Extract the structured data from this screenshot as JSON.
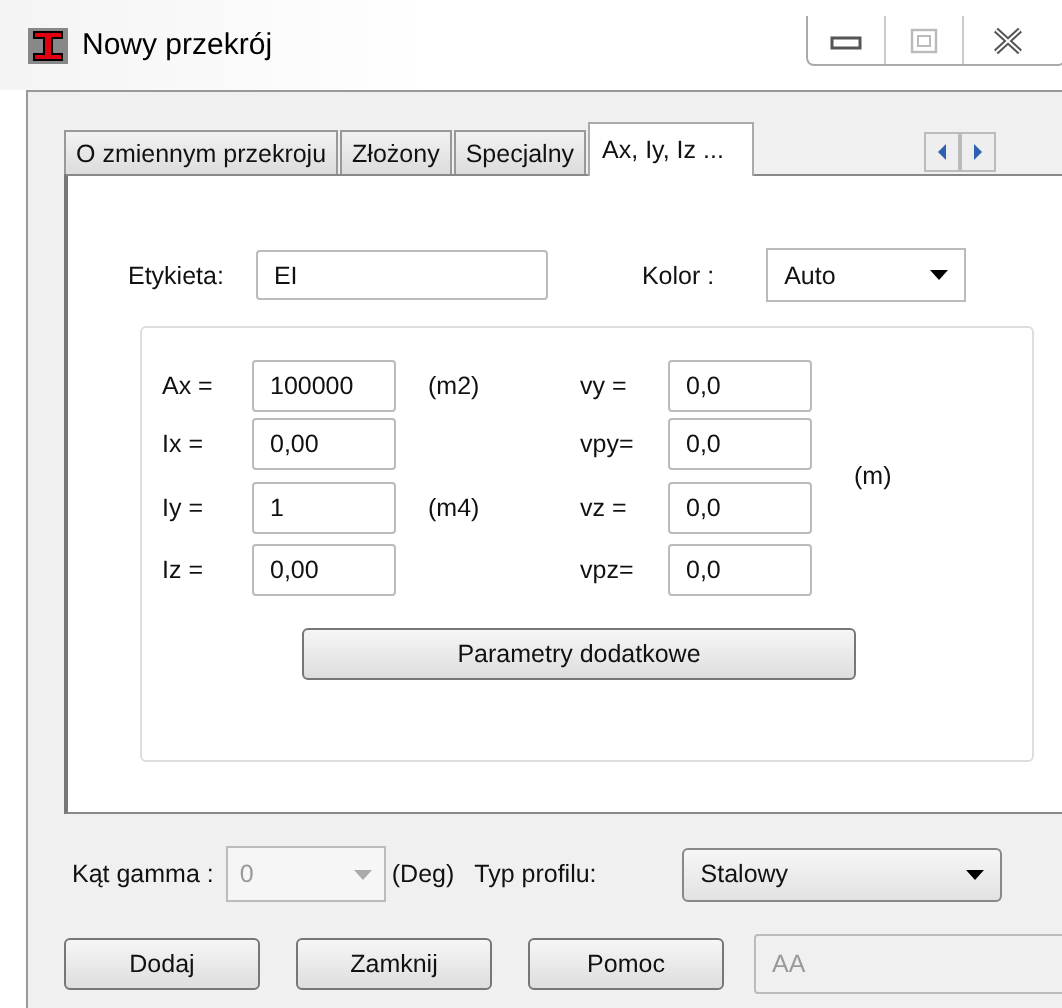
{
  "window": {
    "title": "Nowy przekrój"
  },
  "tabs": [
    {
      "label": "O zmiennym przekroju",
      "selected": false
    },
    {
      "label": "Złożony",
      "selected": false
    },
    {
      "label": "Specjalny",
      "selected": false
    },
    {
      "label": "Ax, Iy, Iz ...",
      "selected": true
    }
  ],
  "label_field": {
    "label": "Etykieta:",
    "value": "EI"
  },
  "color_field": {
    "label": "Kolor :",
    "value": "Auto"
  },
  "properties": {
    "left": [
      {
        "label": "Ax =",
        "value": "100000",
        "unit": "(m2)"
      },
      {
        "label": "Ix =",
        "value": "0,00"
      },
      {
        "label": "Iy =",
        "value": "1",
        "unit": "(m4)"
      },
      {
        "label": "Iz =",
        "value": "0,00"
      }
    ],
    "right": [
      {
        "label": "vy =",
        "value": "0,0"
      },
      {
        "label": "vpy=",
        "value": "0,0"
      },
      {
        "label": "vz =",
        "value": "0,0"
      },
      {
        "label": "vpz=",
        "value": "0,0"
      }
    ],
    "right_unit": "(m)",
    "button": "Parametry dodatkowe"
  },
  "gamma": {
    "label": "Kąt gamma :",
    "value": "0",
    "disabled": true,
    "unit": "(Deg)"
  },
  "profile": {
    "label": "Typ profilu:",
    "value": "Stalowy"
  },
  "buttons": [
    "Dodaj",
    "Zamknij",
    "Pomoc"
  ],
  "code_field": {
    "value": "AA",
    "disabled": true
  }
}
